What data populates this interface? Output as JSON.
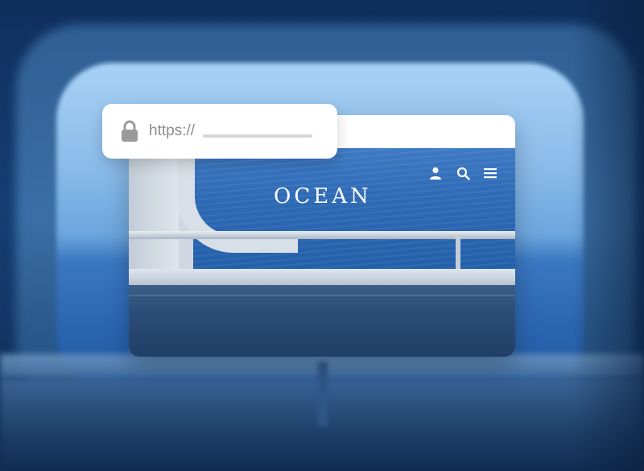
{
  "address_bar": {
    "url_prefix": "https://",
    "lock_icon": "lock-icon"
  },
  "site": {
    "logo": "OCEAN",
    "nav_icons": [
      "user-icon",
      "search-icon",
      "menu-icon"
    ]
  },
  "colors": {
    "logo_text": "#ffffff",
    "url_text": "#8c8c8c",
    "sea": "#2e6ab6",
    "card_bg": "#ffffff"
  }
}
